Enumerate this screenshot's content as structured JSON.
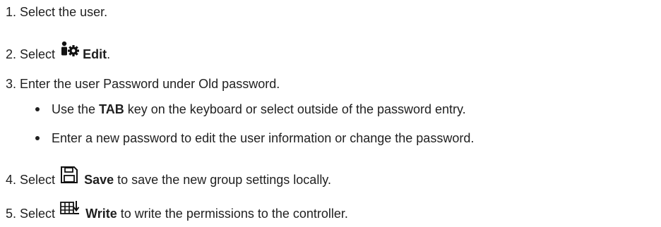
{
  "steps": [
    {
      "number": "1.",
      "text": "Select the user."
    },
    {
      "number": "2.",
      "prefix": "Select",
      "icon": "user-gear-icon",
      "bold": "Edit",
      "suffix": "."
    },
    {
      "number": "3.",
      "text": "Enter the user Password under Old password.",
      "bullets": [
        {
          "prefix": "Use the",
          "bold": "TAB",
          "suffix": "key on the keyboard or select outside of the password entry."
        },
        {
          "text": "Enter a new password to edit the user information or change the password."
        }
      ]
    },
    {
      "number": "4.",
      "prefix": "Select",
      "icon": "floppy-disk-icon",
      "bold": "Save",
      "suffix": "to save the new group settings locally."
    },
    {
      "number": "5.",
      "prefix": "Select",
      "icon": "write-download-icon",
      "bold": "Write",
      "suffix": "to write the permissions to the controller."
    }
  ]
}
